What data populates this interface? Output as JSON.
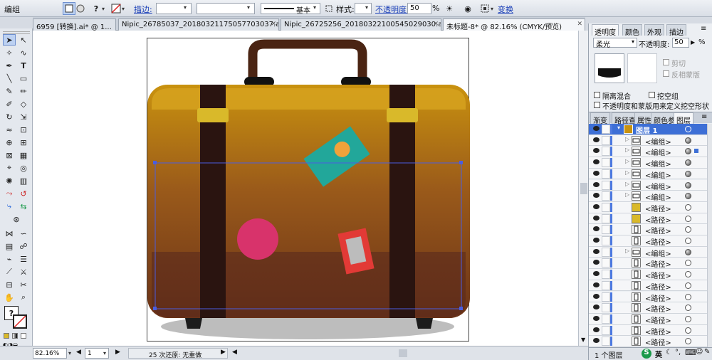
{
  "control_bar": {
    "mode_label": "编组",
    "stroke_label": "描边:",
    "stroke_style": "基本",
    "style_label": "样式:",
    "opacity_label": "不透明度:",
    "opacity_value": "50",
    "opacity_unit": "%",
    "transform_label": "变换"
  },
  "tabs": [
    {
      "label": "6959 [转换].ai* @ 1..."
    },
    {
      "label": "Nipic_26785037_20180321175057703037.ai*"
    },
    {
      "label": "Nipic_26725256_20180322100545029030.ai*"
    },
    {
      "label": "未标题-8* @ 82.16% (CMYK/预览)",
      "active": true
    }
  ],
  "status_bar": {
    "zoom": "82.16%",
    "page": "1",
    "undo_text": "25 次还原: 无重做"
  },
  "transparency_panel": {
    "tabs": [
      "透明度",
      "颜色",
      "外观",
      "描边"
    ],
    "blend_mode": "柔光",
    "opacity_label": "不透明度:",
    "opacity_value": "50",
    "opacity_unit": "%",
    "clip_label": "剪切",
    "invert_mask_label": "反相蒙版",
    "isolate_label": "隔离混合",
    "knockout_label": "挖空组",
    "opacity_mask_label": "不透明度和蒙版用来定义挖空形状"
  },
  "layers_panel": {
    "tabs": [
      "渐变",
      "路径查",
      "属性",
      "颜色参",
      "图层"
    ],
    "footer": "1 个图层",
    "rows": [
      {
        "name": "图层 1",
        "selected": true
      },
      {
        "name": "<编组>"
      },
      {
        "name": "<编组>"
      },
      {
        "name": "<编组>"
      },
      {
        "name": "<编组>"
      },
      {
        "name": "<编组>"
      },
      {
        "name": "<编组>"
      },
      {
        "name": "<路径>"
      },
      {
        "name": "<路径>"
      },
      {
        "name": "<路径>"
      },
      {
        "name": "<路径>"
      },
      {
        "name": "<编组>"
      },
      {
        "name": "<路径>"
      },
      {
        "name": "<路径>"
      },
      {
        "name": "<路径>"
      },
      {
        "name": "<路径>"
      },
      {
        "name": "<路径>"
      },
      {
        "name": "<路径>"
      },
      {
        "name": "<路径>"
      },
      {
        "name": "<路径>"
      }
    ]
  },
  "colors": {
    "accent": "#3d6fd6",
    "suitcase_top": "#c9920f",
    "suitcase_bottom": "#6b3318",
    "strap": "#2a1410",
    "buckle": "#d9b92a",
    "sticker_teal": "#22a79a",
    "sticker_orange": "#f1a23a",
    "sticker_pink": "#d8336b",
    "sticker_red": "#e23a36"
  }
}
